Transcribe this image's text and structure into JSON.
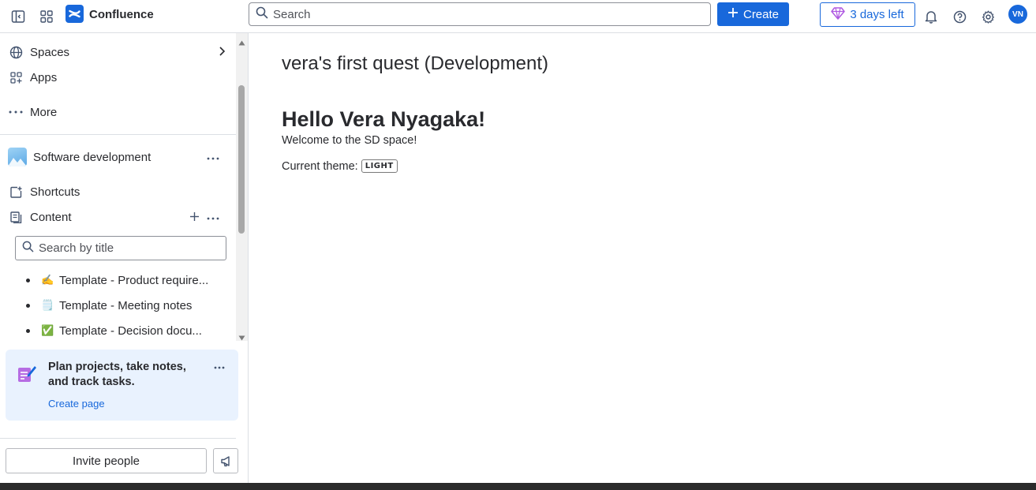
{
  "topbar": {
    "brand": "Confluence",
    "search_placeholder": "Search",
    "create_label": "Create",
    "trial_label": "3 days left",
    "avatar_initials": "VN"
  },
  "sidebar": {
    "nav": [
      {
        "label": "Spaces",
        "icon": "globe-icon"
      },
      {
        "label": "Apps",
        "icon": "apps-icon"
      },
      {
        "label": "More",
        "icon": "more-dots-icon"
      }
    ],
    "space_name": "Software development",
    "shortcuts_label": "Shortcuts",
    "content_label": "Content",
    "title_search_placeholder": "Search by title",
    "tree": [
      {
        "emoji": "✍️",
        "label": "Template - Product require..."
      },
      {
        "emoji": "🗒️",
        "label": "Template - Meeting notes"
      },
      {
        "emoji": "✅",
        "label": "Template - Decision docu..."
      }
    ],
    "promo": {
      "title": "Plan projects, take notes, and track tasks.",
      "link": "Create page"
    },
    "invite_label": "Invite people"
  },
  "main": {
    "page_title": "vera's first quest (Development)",
    "heading": "Hello Vera Nyagaka!",
    "welcome": "Welcome to the SD space!",
    "theme_label": "Current theme:",
    "theme_value": "LIGHT"
  },
  "colors": {
    "accent": "#1868DB",
    "promo_bg": "#E9F2FE",
    "text": "#292A2E"
  }
}
